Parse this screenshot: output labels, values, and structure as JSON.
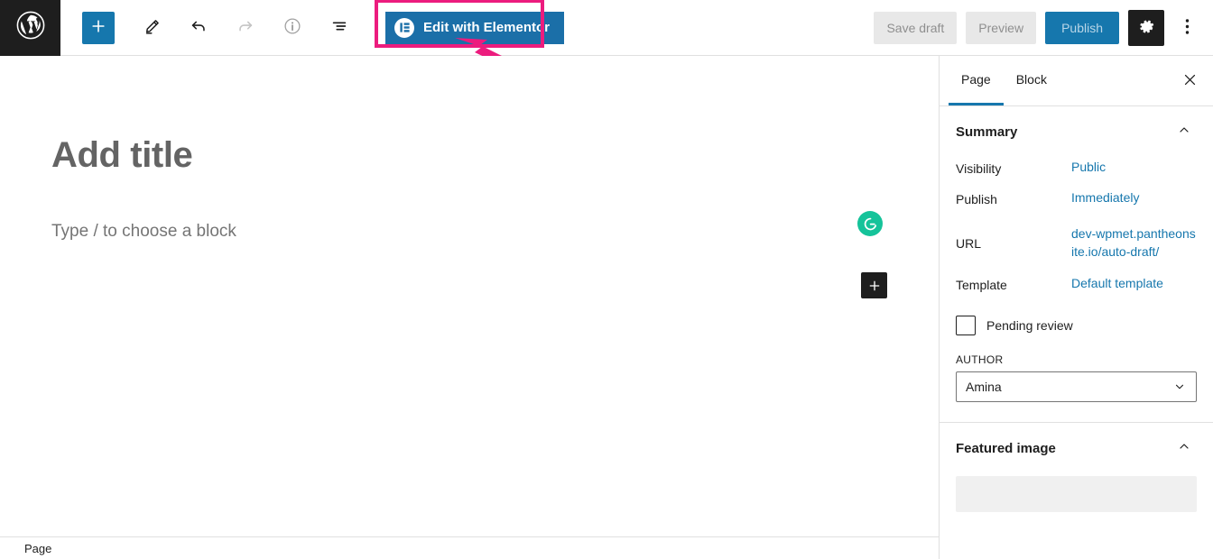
{
  "toolbar": {
    "wp_logo": "wordpress-logo",
    "add_block_label": "+",
    "tools_icon": "pencil-icon",
    "undo_icon": "undo-icon",
    "redo_icon": "redo-icon",
    "info_icon": "info-icon",
    "list_view_icon": "list-view-icon",
    "elementor_button_label": "Edit with Elementor",
    "save_draft_label": "Save draft",
    "preview_label": "Preview",
    "publish_label": "Publish",
    "settings_icon": "gear-icon",
    "more_icon": "ellipsis-vertical-icon"
  },
  "editor": {
    "title_placeholder": "Add title",
    "block_placeholder": "Type / to choose a block",
    "grammarly_icon_label": "G",
    "inserter_label": "+",
    "breadcrumb": "Page"
  },
  "sidebar": {
    "tabs": [
      {
        "label": "Page",
        "active": true
      },
      {
        "label": "Block",
        "active": false
      }
    ],
    "close_icon": "close-icon",
    "summary": {
      "title": "Summary",
      "collapse_icon": "chevron-up-icon",
      "rows": [
        {
          "label": "Visibility",
          "value": "Public"
        },
        {
          "label": "Publish",
          "value": "Immediately"
        },
        {
          "label": "Template",
          "value": "Default template"
        }
      ],
      "url_label": "URL",
      "url_value": "dev-wpmet.pantheonsite.io/auto-draft/",
      "pending_review_label": "Pending review",
      "pending_review_checked": false,
      "author_label": "AUTHOR",
      "author_value": "Amina"
    },
    "featured_image": {
      "title": "Featured image",
      "collapse_icon": "chevron-up-icon"
    }
  },
  "colors": {
    "accent_blue": "#1677ad",
    "highlight_pink": "#ec1c7e",
    "elementor_blue": "#1b6fa8",
    "grammarly_green": "#15c39a",
    "dark": "#1e1e1e"
  }
}
